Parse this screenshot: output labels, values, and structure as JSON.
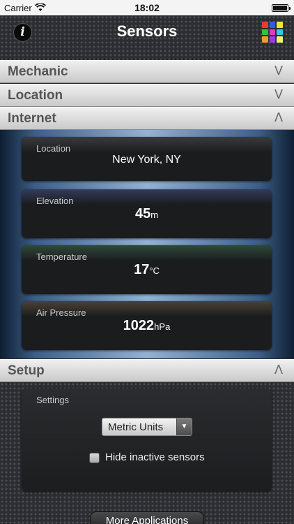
{
  "status_bar": {
    "carrier": "Carrier",
    "time": "18:02"
  },
  "nav": {
    "title": "Sensors",
    "info_icon": "i",
    "grid_icon": "color-grid-icon"
  },
  "sections": {
    "mechanic": {
      "label": "Mechanic",
      "chevron": "V"
    },
    "location": {
      "label": "Location",
      "chevron": "V"
    },
    "internet": {
      "label": "Internet",
      "chevron": "Λ"
    },
    "setup": {
      "label": "Setup",
      "chevron": "Λ"
    }
  },
  "internet": {
    "location": {
      "label": "Location",
      "value": "New York, NY"
    },
    "elevation": {
      "label": "Elevation",
      "value": "45",
      "unit": "m"
    },
    "temperature": {
      "label": "Temperature",
      "value": "17",
      "unit": "°C"
    },
    "pressure": {
      "label": "Air Pressure",
      "value": "1022",
      "unit": "hPa"
    }
  },
  "setup": {
    "settings_label": "Settings",
    "units": {
      "selected": "Metric Units"
    },
    "hide_inactive": {
      "label": "Hide inactive sensors",
      "checked": false
    }
  },
  "footer": {
    "more_apps": "More Applications"
  },
  "colors": {
    "grid_cells": [
      "#e43b3b",
      "#2f5fe0",
      "#f0e82e",
      "#2ec43b",
      "#e03ac7",
      "#35c7e6",
      "#f09a2e",
      "#9a3be0",
      "#f2f26e"
    ]
  }
}
